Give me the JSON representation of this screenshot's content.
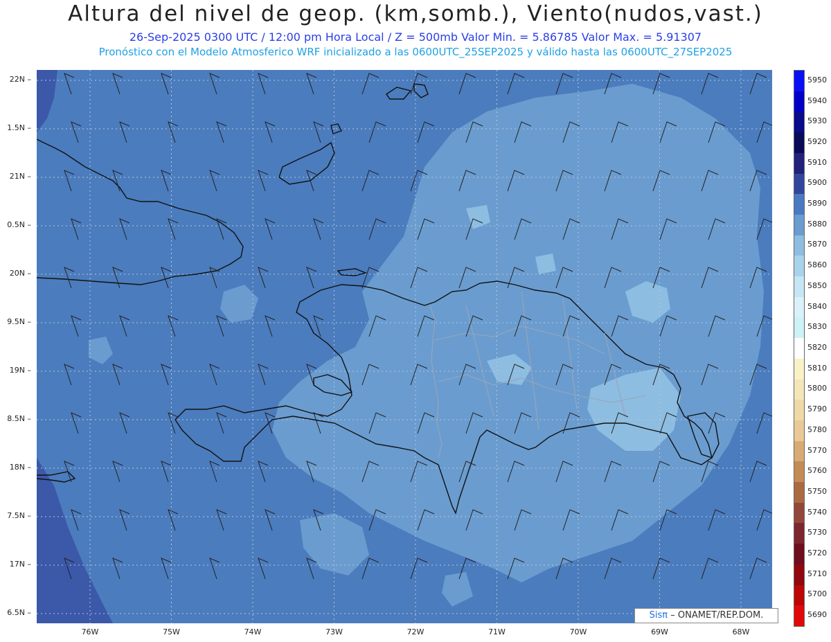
{
  "header": {
    "title": "Altura del nivel de geop. (km,somb.), Viento(nudos,vast.)",
    "subtitle": "26-Sep-2025  0300 UTC / 12:00 pm Hora Local / Z = 500mb    Valor Min. = 5.86785   Valor Max. = 5.91307",
    "model_line": "Pronóstico con el Modelo Atmosferico WRF inicializado a las 0600UTC_25SEP2025 y válido hasta las  0600UTC_27SEP2025"
  },
  "map": {
    "lat_labels": [
      "22N",
      "1.5N",
      "21N",
      "0.5N",
      "20N",
      "9.5N",
      "19N",
      "8.5N",
      "18N",
      "7.5N",
      "17N",
      "6.5N"
    ],
    "lon_labels": [
      "76W",
      "75W",
      "74W",
      "73W",
      "72W",
      "71W",
      "70W",
      "69W",
      "68W"
    ],
    "colors": {
      "ocean": "#4b7cbd",
      "deep": "#3c58a8",
      "mid": "#6a9ccf",
      "light": "#8dbde0",
      "lightest": "#a9d3ec",
      "coast": "#111111",
      "border": "#9aa5b8"
    }
  },
  "legend": {
    "levels": [
      "5950",
      "5940",
      "5930",
      "5920",
      "5910",
      "5900",
      "5890",
      "5880",
      "5870",
      "5860",
      "5850",
      "5840",
      "5830",
      "5820",
      "5810",
      "5800",
      "5790",
      "5780",
      "5770",
      "5760",
      "5750",
      "5740",
      "5730",
      "5720",
      "5710",
      "5700",
      "5690"
    ],
    "colors": [
      "#0a10f5",
      "#0000c8",
      "#0a0a8c",
      "#0a0a5a",
      "#22227a",
      "#33469e",
      "#4a7ac0",
      "#6a9ccf",
      "#8dbde0",
      "#a9d3ec",
      "#c5e6f3",
      "#dbf1f9",
      "#cdf2f8",
      "#ffffff",
      "#f9f2c9",
      "#f4e6b9",
      "#efd9a6",
      "#e9c995",
      "#d9ab74",
      "#c48c55",
      "#ab6a42",
      "#93473a",
      "#7e2630",
      "#6e0e1e",
      "#910710",
      "#bd0606",
      "#e00a0a"
    ]
  },
  "credit": {
    "sis": "Sisπ",
    "text": "– ONAMET/REP.DOM."
  }
}
